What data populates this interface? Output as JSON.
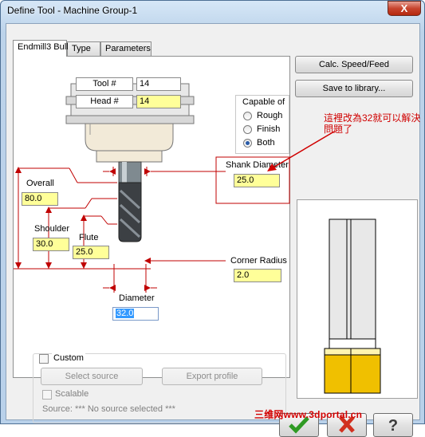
{
  "window": {
    "title": "Define Tool - Machine Group-1",
    "close_glyph": "X"
  },
  "tabs": [
    {
      "label": "Endmill3 Bull"
    },
    {
      "label": "Type"
    },
    {
      "label": "Parameters"
    }
  ],
  "holder": {
    "tool_no_label": "Tool #",
    "tool_no_value": "14",
    "head_no_label": "Head #",
    "head_no_value": "14"
  },
  "capable": {
    "title": "Capable of",
    "options": [
      "Rough",
      "Finish",
      "Both"
    ],
    "selected": "Both"
  },
  "dimensions": {
    "shank_label": "Shank Diameter",
    "shank_value": "25.0",
    "overall_label": "Overall",
    "overall_value": "80.0",
    "shoulder_label": "Shoulder",
    "shoulder_value": "30.0",
    "flute_label": "Flute",
    "flute_value": "25.0",
    "corner_label": "Corner Radius",
    "corner_value": "2.0",
    "diameter_label": "Diameter",
    "diameter_value": "32.0"
  },
  "custom": {
    "label": "Custom",
    "select_source": "Select source",
    "export_profile": "Export profile",
    "scalable": "Scalable",
    "source": "Source: *** No source selected ***"
  },
  "buttons": {
    "calc": "Calc. Speed/Feed",
    "save_library": "Save to library..."
  },
  "annotation": "這裡改為32就可以解決問題了",
  "watermark": "三维网www.3dportal.cn",
  "colors": {
    "accent_red": "#d00000",
    "field_yellow": "#ffff99"
  }
}
